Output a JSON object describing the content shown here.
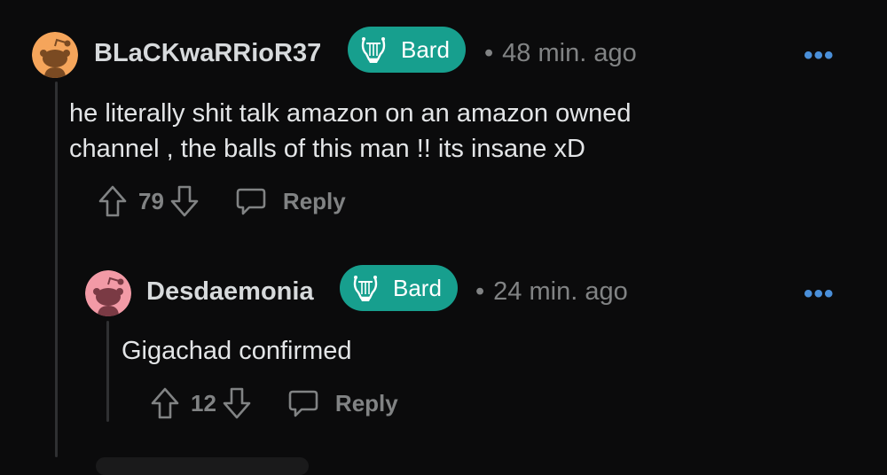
{
  "comments": [
    {
      "username": "BLaCKwaRRioR37",
      "flair": "Bard",
      "time": "48 min. ago",
      "dot": "•",
      "more": "•••",
      "body": [
        "he literally shit talk amazon on an amazon owned",
        "channel , the balls of this man !! its insane xD"
      ],
      "votes": "79",
      "reply_label": "Reply",
      "avatar_color": "#f5a55b"
    },
    {
      "username": "Desdaemonia",
      "flair": "Bard",
      "time": "24 min. ago",
      "dot": "•",
      "more": "•••",
      "body": [
        "Gigachad confirmed"
      ],
      "votes": "12",
      "reply_label": "Reply",
      "avatar_color": "#f29aa6"
    }
  ],
  "colors": {
    "flair_bg": "#179f8e",
    "more_dots": "#4a8fd9",
    "muted": "#818384"
  }
}
